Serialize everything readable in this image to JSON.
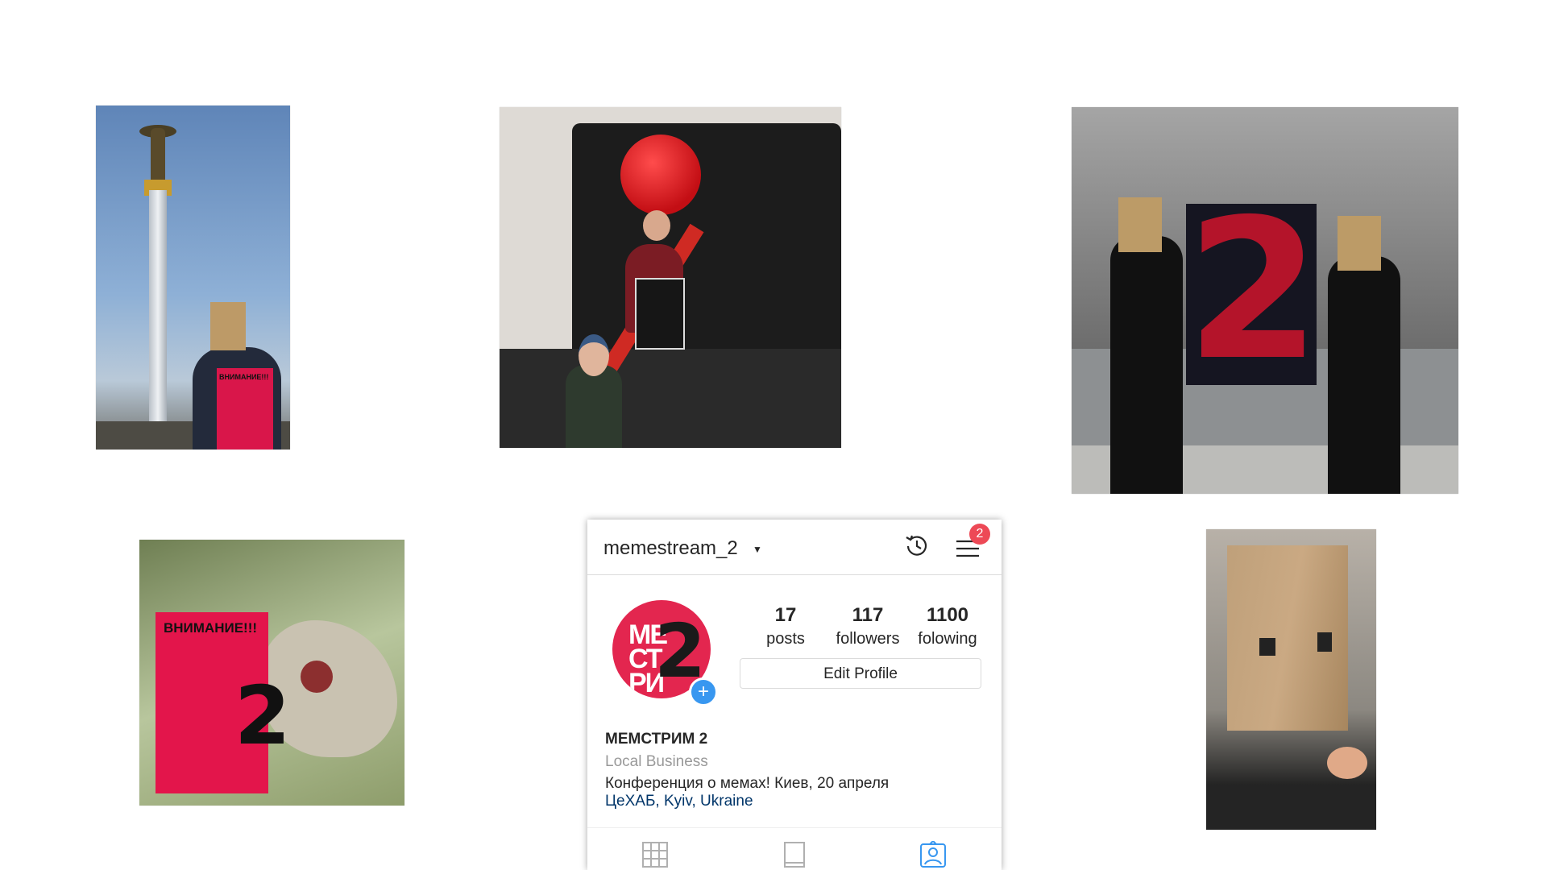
{
  "profile": {
    "username": "memestream_2",
    "notification_count": "2",
    "stats": [
      {
        "value": "17",
        "label": "posts"
      },
      {
        "value": "117",
        "label": "followers"
      },
      {
        "value": "1100",
        "label": "folowing"
      }
    ],
    "edit_label": "Edit Profile",
    "full_name": "МЕМСТРИМ 2",
    "category": "Local Business",
    "bio": "Конференция о мемах! Киев, 20 апреля",
    "location": "ЦеХАБ, Kyiv, Ukraine",
    "avatar_text_line1": "МЕ",
    "avatar_text_line2": "СТ",
    "avatar_text_line3": "РИ",
    "avatar_big": "2"
  },
  "photos": {
    "p1_poster_title": "ВНИМАНИЕ!!!",
    "p3_banner_digit": "2",
    "p4_poster_title": "ВНИМАНИЕ!!!",
    "p4_poster_digit": "2"
  },
  "icons": {
    "caret": "chevron-down-icon",
    "history": "history-icon",
    "menu": "menu-icon",
    "add": "add-icon",
    "grid": "grid-icon",
    "feed": "feed-icon",
    "tagged": "tagged-icon"
  },
  "colors": {
    "accent": "#3897f0",
    "notification": "#ed4956",
    "brand_red": "#e3264f"
  }
}
